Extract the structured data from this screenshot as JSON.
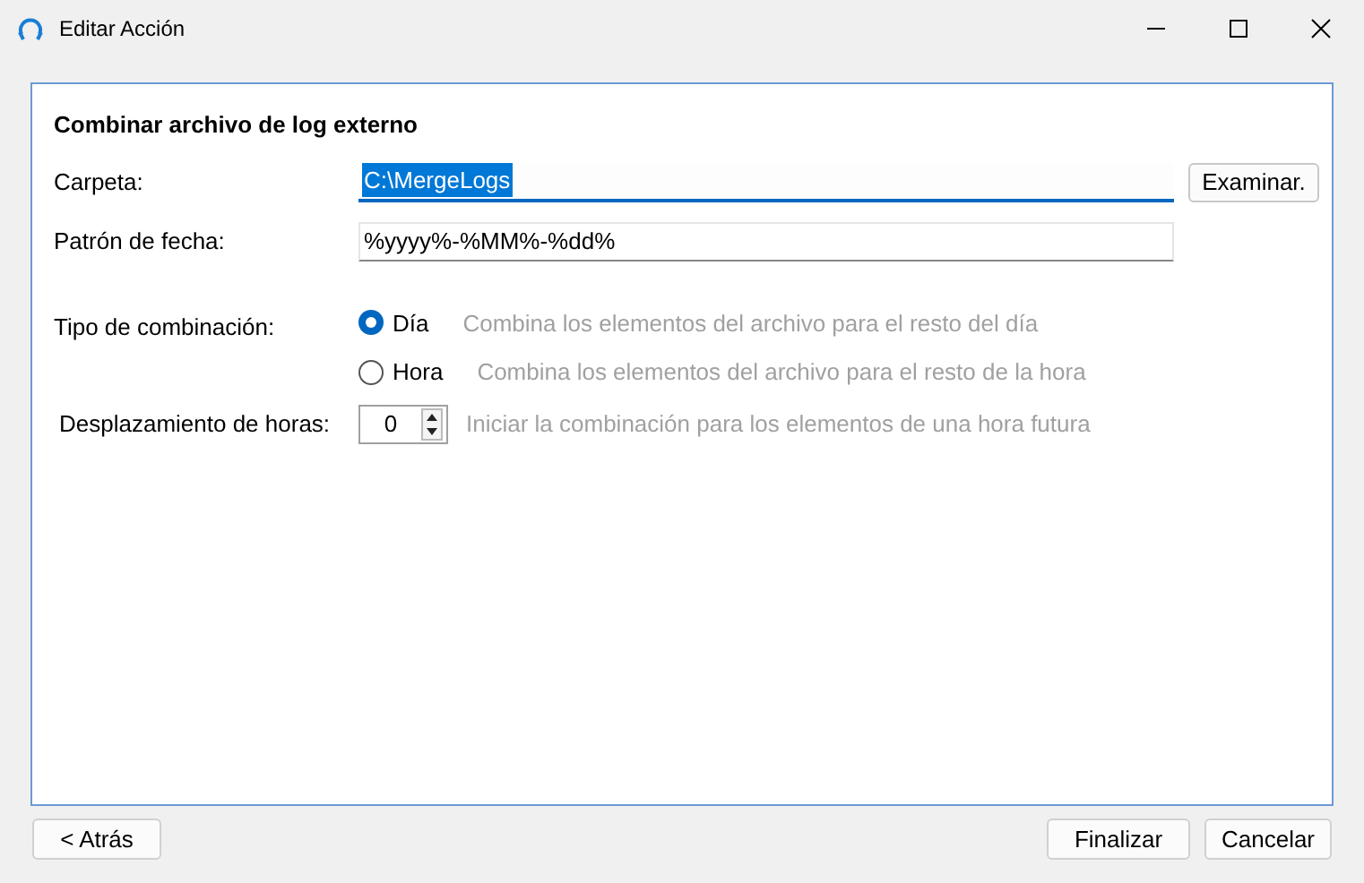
{
  "window": {
    "title": "Editar Acción"
  },
  "panel": {
    "heading": "Combinar archivo de log externo",
    "folder": {
      "label": "Carpeta:",
      "value": "C:\\MergeLogs",
      "browse": "Examinar."
    },
    "date_pattern": {
      "label": "Patrón de fecha:",
      "value": "%yyyy%-%MM%-%dd%"
    },
    "merge_type": {
      "label": "Tipo de combinación:",
      "options": [
        {
          "label": "Día",
          "description": "Combina los elementos del archivo para el resto del día",
          "selected": true
        },
        {
          "label": "Hora",
          "description": "Combina los elementos del archivo para el resto de la hora",
          "selected": false
        }
      ]
    },
    "hour_offset": {
      "label": "Desplazamiento de horas:",
      "value": "0",
      "description": "Iniciar la combinación para los elementos de una hora futura"
    }
  },
  "buttons": {
    "back": "< Atrás",
    "finish": "Finalizar",
    "cancel": "Cancelar"
  }
}
